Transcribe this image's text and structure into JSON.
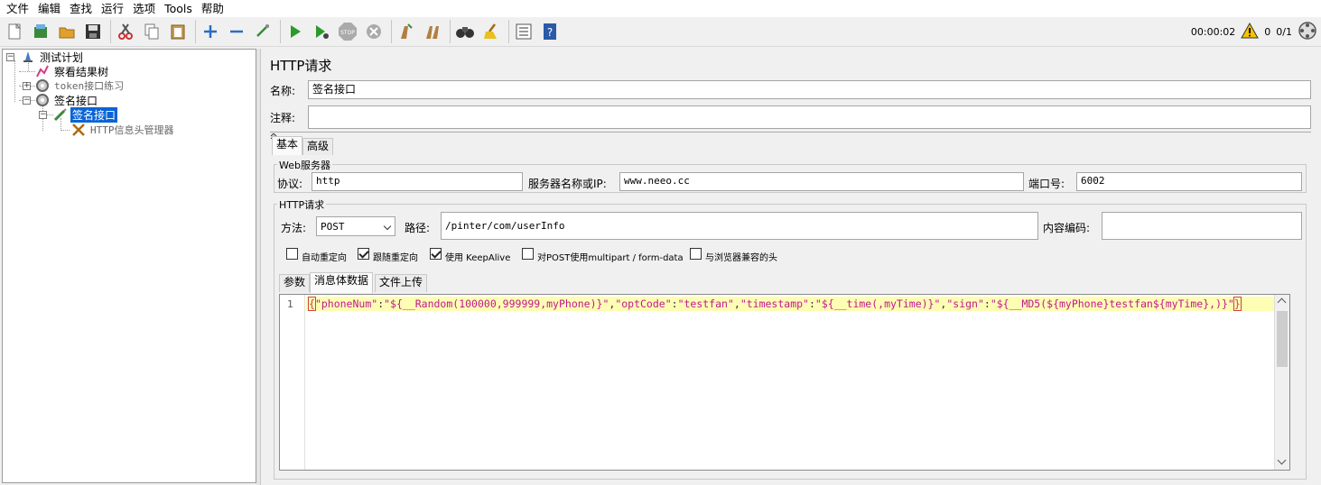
{
  "menu": [
    "文件",
    "编辑",
    "查找",
    "运行",
    "选项",
    "Tools",
    "帮助"
  ],
  "status": {
    "timer": "00:00:02",
    "warnings": "0",
    "threads": "0/1"
  },
  "tree": {
    "root": "测试计划",
    "items": [
      "察看结果树",
      "token接口练习",
      "签名接口",
      "签名接口",
      "HTTP信息头管理器"
    ]
  },
  "panel": {
    "title": "HTTP请求",
    "name_label": "名称:",
    "name_value": "签名接口",
    "comment_label": "注释:",
    "comment_value": "",
    "tabs": [
      "基本",
      "高级"
    ],
    "web_server": {
      "legend": "Web服务器",
      "protocol_label": "协议:",
      "protocol_value": "http",
      "server_label": "服务器名称或IP:",
      "server_value": "www.neeo.cc",
      "port_label": "端口号:",
      "port_value": "6002"
    },
    "http_request": {
      "legend": "HTTP请求",
      "method_label": "方法:",
      "method_value": "POST",
      "path_label": "路径:",
      "path_value": "/pinter/com/userInfo",
      "encoding_label": "内容编码:",
      "encoding_value": ""
    },
    "checkboxes": [
      {
        "label": "自动重定向",
        "checked": false
      },
      {
        "label": "跟随重定向",
        "checked": true
      },
      {
        "label": "使用 KeepAlive",
        "checked": true
      },
      {
        "label": "对POST使用multipart / form-data",
        "checked": false
      },
      {
        "label": "与浏览器兼容的头",
        "checked": false
      }
    ],
    "body_tabs": [
      "参数",
      "消息体数据",
      "文件上传"
    ],
    "editor": {
      "line_number": "1",
      "code": "{\"phoneNum\":\"${__Random(100000,999999,myPhone)}\",\"optCode\":\"testfan\",\"timestamp\":\"${__time(,myTime)}\",\"sign\":\"${__MD5(${myPhone}testfan${myTime},)}\"}"
    }
  }
}
